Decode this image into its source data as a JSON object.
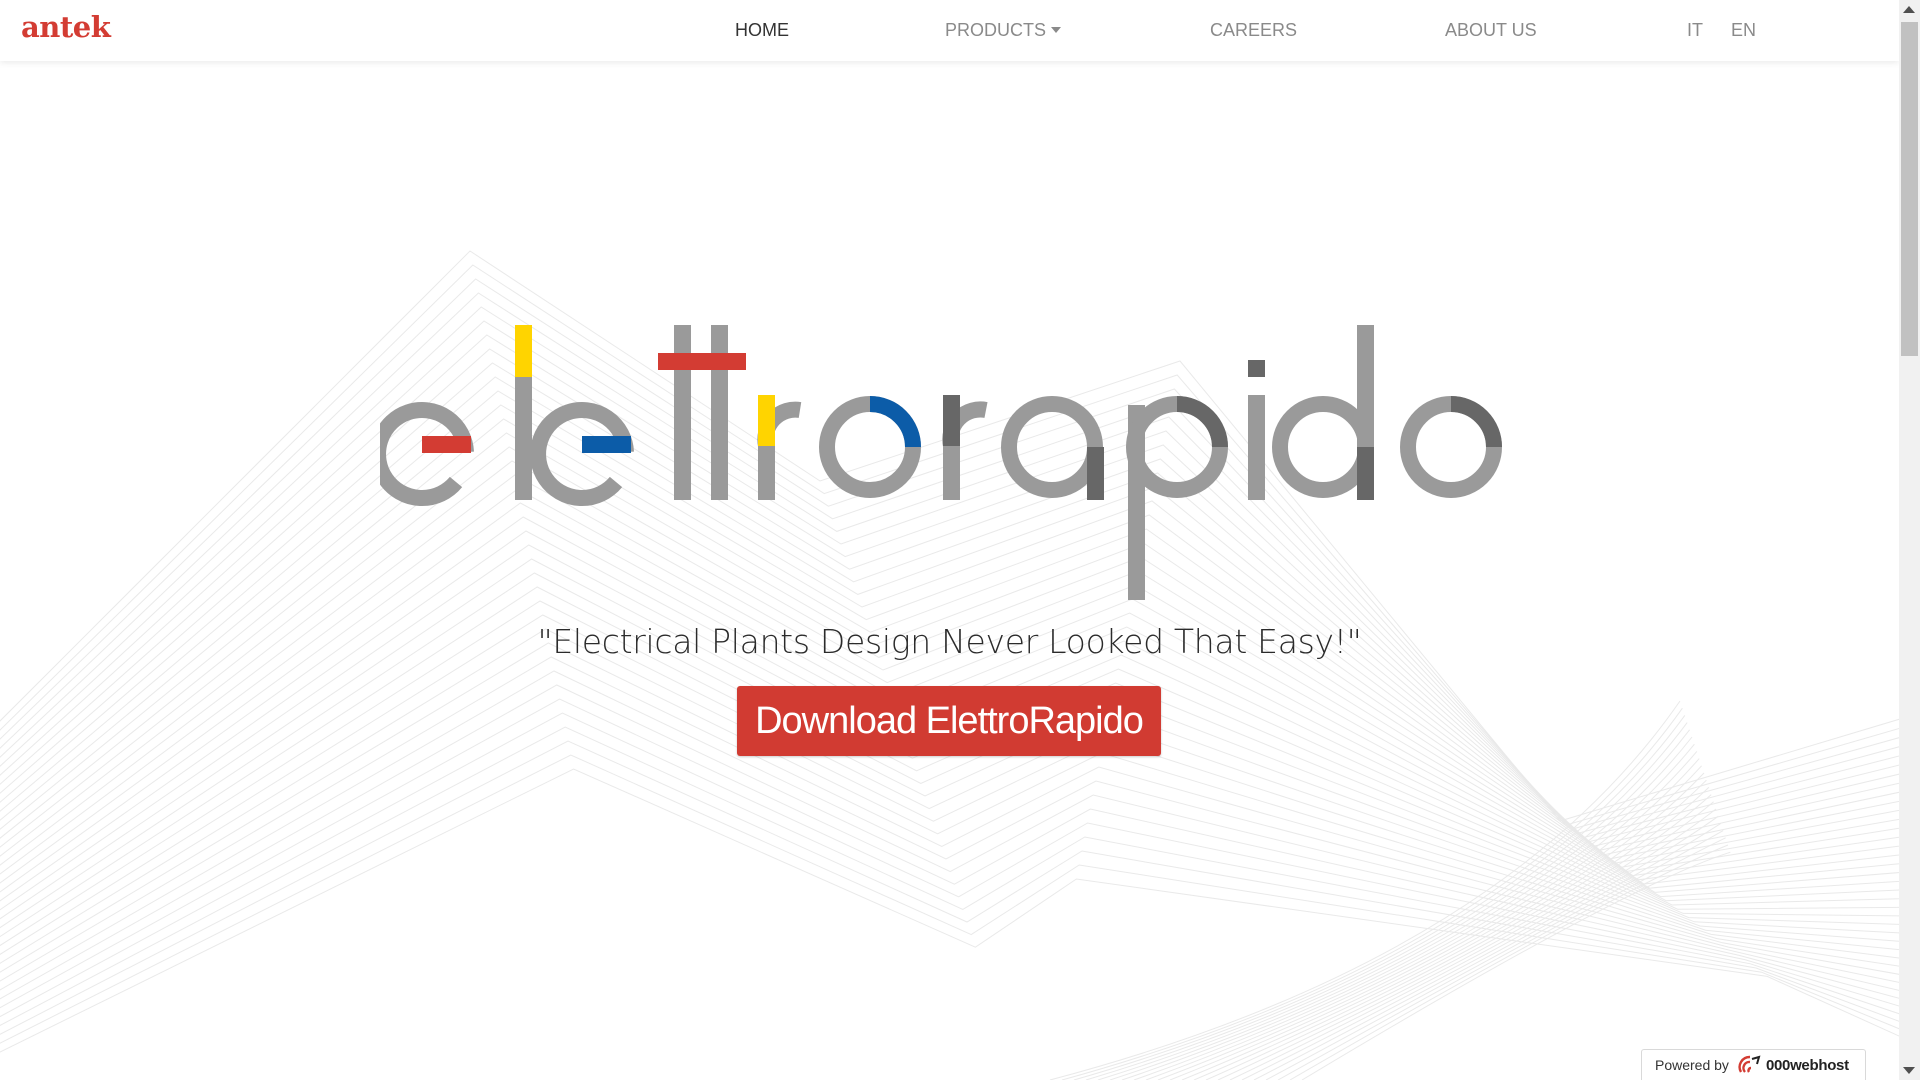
{
  "navbar": {
    "brand": "antek",
    "links": [
      {
        "label": "HOME",
        "active": true
      },
      {
        "label": "PRODUCTS",
        "dropdown": true
      },
      {
        "label": "CAREERS"
      },
      {
        "label": "ABOUT US"
      }
    ],
    "languages": [
      "IT",
      "EN"
    ]
  },
  "hero": {
    "logo_text": "elettrorapido",
    "tagline": "\"Electrical Plants Design Never Looked That Easy!\"",
    "download_label": "Download ElettroRapido"
  },
  "badge": {
    "powered_label": "Powered by",
    "host_name": "000webhost"
  },
  "colors": {
    "brand_red": "#d33c33",
    "logo_gray": "#9a9a9a",
    "logo_dark": "#676767",
    "accent_yellow": "#ffd400",
    "accent_blue": "#0c5ca8",
    "accent_red": "#d33c33"
  }
}
